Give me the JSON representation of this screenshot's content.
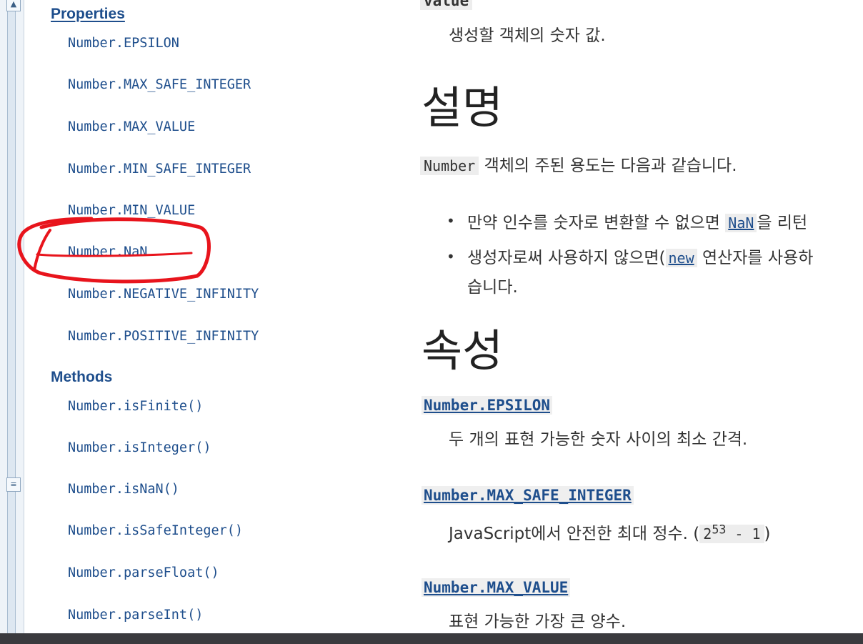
{
  "nav": {
    "properties_heading": "Properties",
    "properties": [
      "Number.EPSILON",
      "Number.MAX_SAFE_INTEGER",
      "Number.MAX_VALUE",
      "Number.MIN_SAFE_INTEGER",
      "Number.MIN_VALUE",
      "Number.NaN",
      "Number.NEGATIVE_INFINITY",
      "Number.POSITIVE_INFINITY"
    ],
    "methods_heading": "Methods",
    "methods": [
      "Number.isFinite()",
      "Number.isInteger()",
      "Number.isNaN()",
      "Number.isSafeInteger()",
      "Number.parseFloat()",
      "Number.parseInt()"
    ]
  },
  "main": {
    "value_term": "value",
    "value_desc": "생성할 객체의 숫자 값.",
    "description_heading": "설명",
    "description_code": "Number",
    "description_text": "객체의 주된 용도는 다음과 같습니다.",
    "bullets": [
      {
        "before": "만약 인수를 숫자로 변환할 수 없으면",
        "link": "NaN",
        "after": "을 리턴"
      },
      {
        "before": "생성자로써 사용하지 않으면(",
        "link": "new",
        "after": " 연산자를 사용하"
      }
    ],
    "bullet2_wrap": "습니다.",
    "properties_heading": "속성",
    "entries": [
      {
        "term": "Number.EPSILON",
        "desc": "두 개의 표현 가능한 숫자 사이의 최소 간격."
      },
      {
        "term": "Number.MAX_SAFE_INTEGER",
        "desc_prefix": "JavaScript에서 안전한 최대 정수. (",
        "formula_base": "2",
        "formula_exp": "53",
        "formula_rest": " - 1",
        "desc_suffix": ")"
      },
      {
        "term": "Number.MAX_VALUE",
        "desc": "표현 가능한 가장 큰 양수."
      }
    ]
  },
  "colors": {
    "link": "#1e4e8c",
    "annotation": "#e8141c",
    "bottom_bar": "#3a3a3e"
  },
  "icons": {
    "scroll_up": "triangle-up",
    "menu": "list-lines"
  }
}
